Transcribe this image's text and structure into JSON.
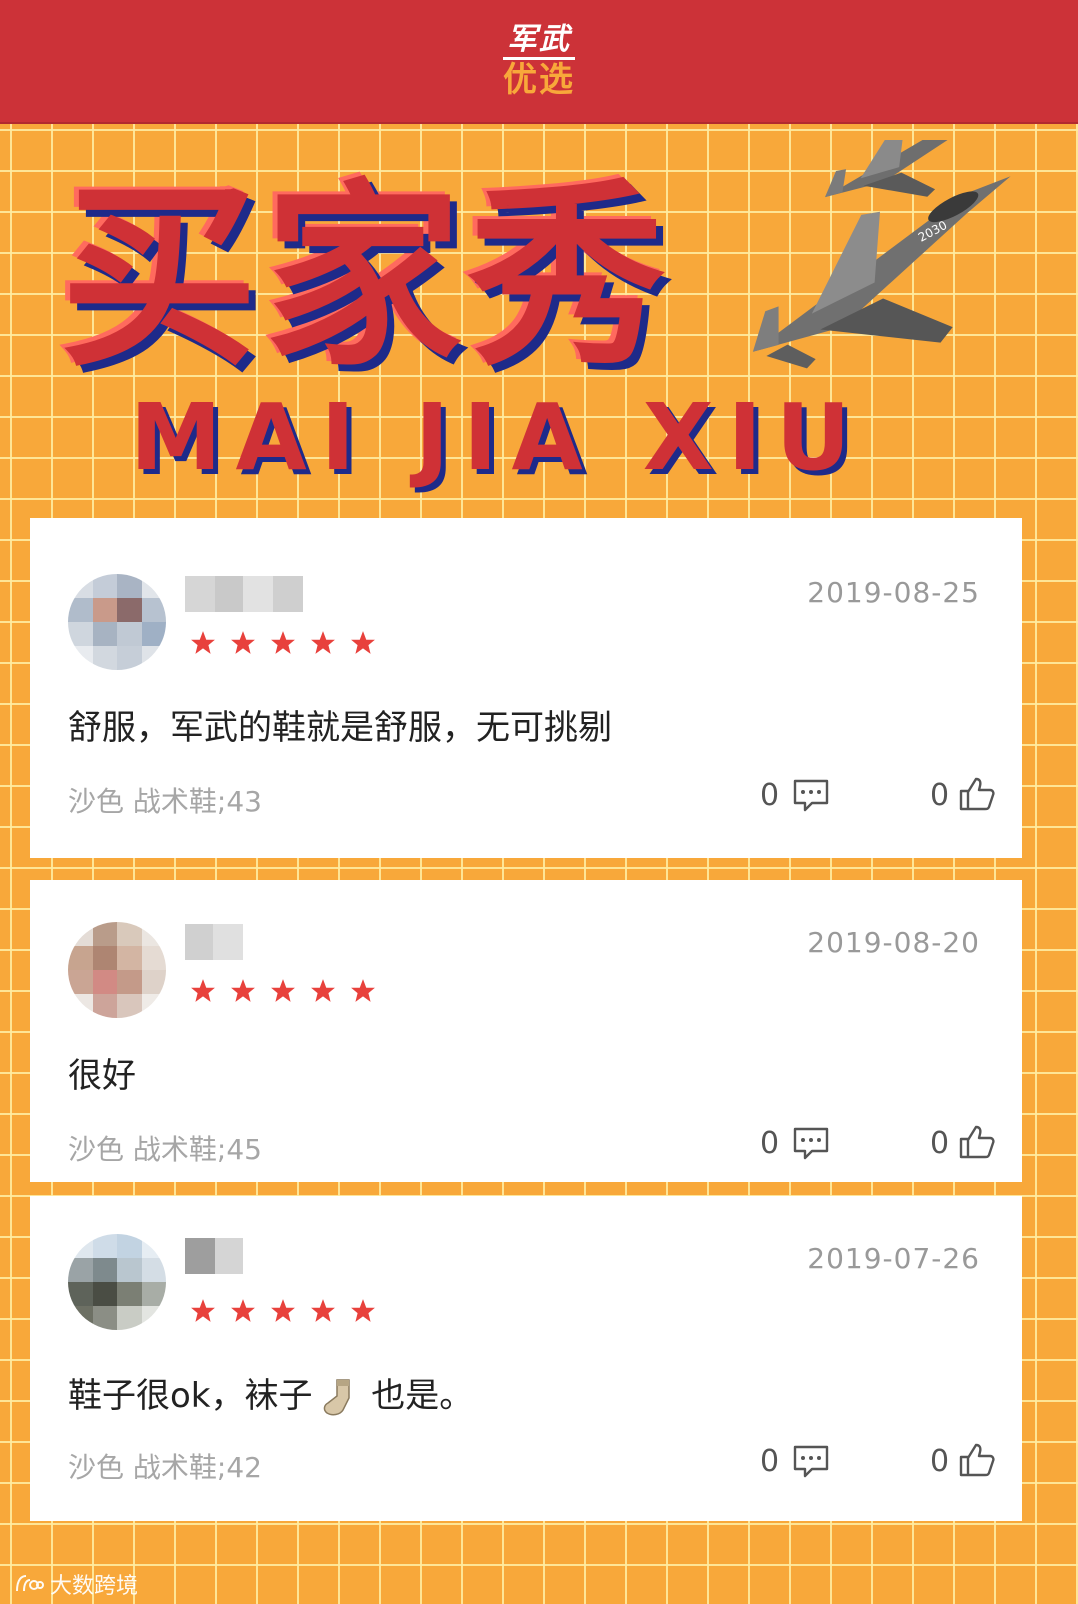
{
  "header": {
    "brand_line1": "军武",
    "brand_line2": "优选"
  },
  "hero": {
    "title": "买家秀",
    "subtitle": "MAI JIA XIU"
  },
  "reviews": [
    {
      "date": "2019-08-25",
      "rating": 5,
      "text": "舒服，军武的鞋就是舒服，无可挑剔",
      "variant": "沙色 战术鞋;43",
      "comment_count": "0",
      "like_count": "0"
    },
    {
      "date": "2019-08-20",
      "rating": 5,
      "text": "很好",
      "variant": "沙色 战术鞋;45",
      "comment_count": "0",
      "like_count": "0"
    },
    {
      "date": "2019-07-26",
      "rating": 5,
      "text_before": "鞋子很ok，袜子",
      "text_after": " 也是。",
      "variant": "沙色 战术鞋;42",
      "comment_count": "0",
      "like_count": "0"
    }
  ],
  "watermark": {
    "text": "大数跨境"
  },
  "icons": {
    "star": "star-icon",
    "comment": "comment-bubble-icon",
    "like": "thumbs-up-icon",
    "sock": "sock-emoji-icon",
    "jet": "fighter-jet-icon"
  },
  "colors": {
    "banner_red": "#cc3238",
    "background_orange": "#f8a83a",
    "star_red": "#e8413c",
    "title_shadow_blue": "#1e2a8a"
  }
}
